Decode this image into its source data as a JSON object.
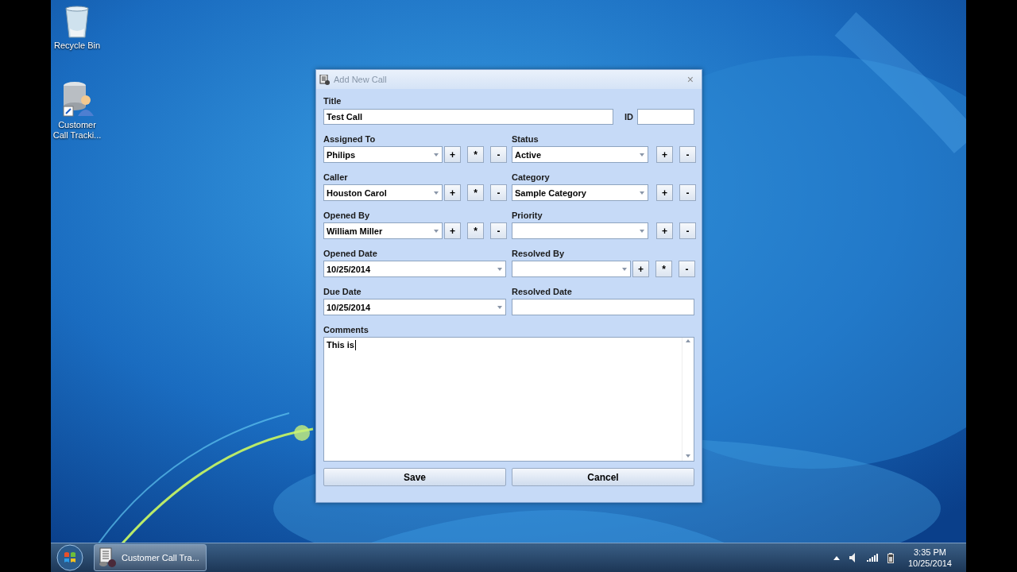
{
  "desktop_icons": [
    {
      "label": "Recycle Bin",
      "kind": "bin"
    },
    {
      "label": "Customer Call Tracki...",
      "kind": "app"
    }
  ],
  "window": {
    "title": "Add New Call",
    "close": "×"
  },
  "title_field": {
    "label": "Title",
    "value": "Test Call"
  },
  "id_field": {
    "label": "ID"
  },
  "rows": [
    {
      "left": {
        "label": "Assigned To",
        "kind": "combo",
        "value": "Philips",
        "buttons": [
          "+",
          "*",
          "-"
        ]
      },
      "right": {
        "label": "Status",
        "kind": "combo",
        "value": "Active",
        "buttons": [
          "+",
          "-"
        ]
      }
    },
    {
      "left": {
        "label": "Caller",
        "kind": "combo",
        "value": "Houston Carol",
        "buttons": [
          "+",
          "*",
          "-"
        ]
      },
      "right": {
        "label": "Category",
        "kind": "combo",
        "value": "Sample Category",
        "buttons": [
          "+",
          "-"
        ]
      }
    },
    {
      "left": {
        "label": "Opened By",
        "kind": "combo",
        "value": "William Miller",
        "buttons": [
          "+",
          "*",
          "-"
        ]
      },
      "right": {
        "label": "Priority",
        "kind": "combo",
        "buttons": [
          "+",
          "-"
        ]
      }
    },
    {
      "left": {
        "label": "Opened Date",
        "kind": "date",
        "value": "10/25/2014"
      },
      "right": {
        "label": "Resolved By",
        "kind": "combo",
        "buttons": [
          "+",
          "*",
          "-"
        ]
      }
    },
    {
      "left": {
        "label": "Due Date",
        "kind": "date",
        "value": "10/25/2014"
      },
      "right": {
        "label": "Resolved Date",
        "kind": "text"
      }
    }
  ],
  "comments": {
    "label": "Comments",
    "value": "This is"
  },
  "buttons": [
    "Save",
    "Cancel"
  ],
  "taskbar": {
    "task": "Customer Call Tra...",
    "time": "3:35 PM",
    "date": "10/25/2014"
  }
}
